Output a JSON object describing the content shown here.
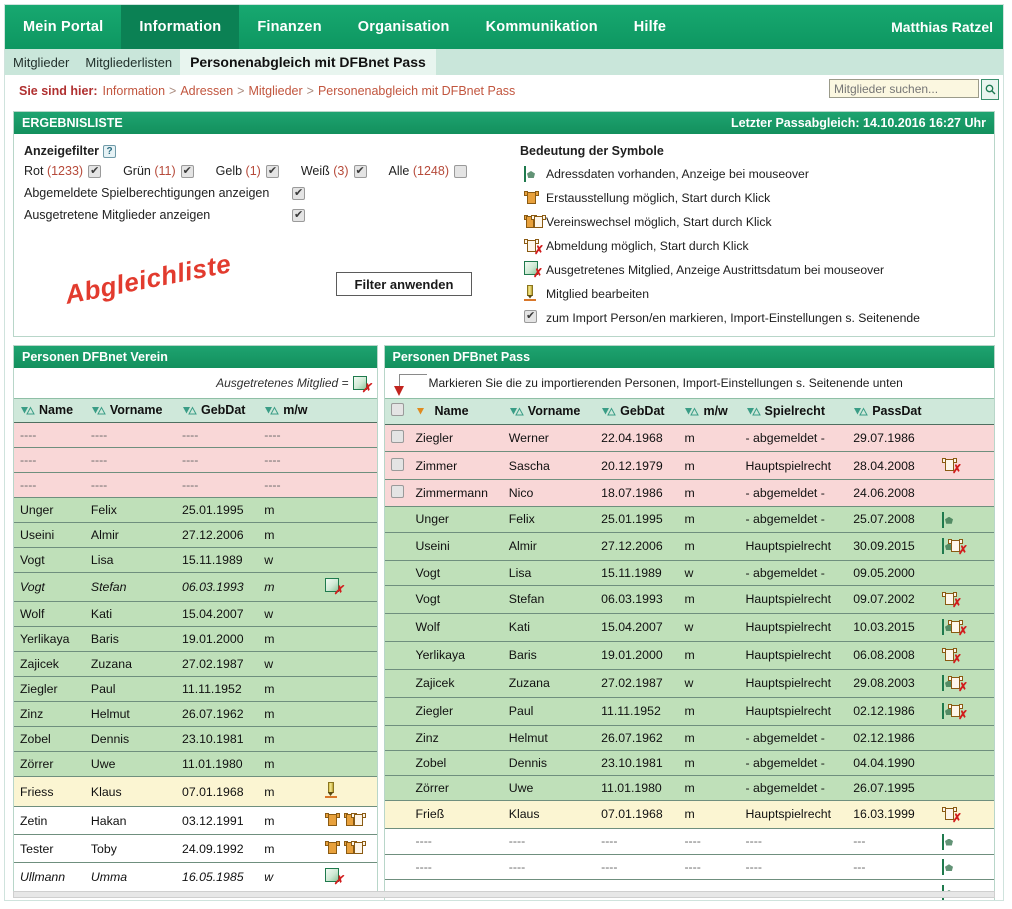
{
  "nav": {
    "items": [
      {
        "label": "Mein Portal",
        "active": false
      },
      {
        "label": "Information",
        "active": true
      },
      {
        "label": "Finanzen",
        "active": false
      },
      {
        "label": "Organisation",
        "active": false
      },
      {
        "label": "Kommunikation",
        "active": false
      },
      {
        "label": "Hilfe",
        "active": false
      }
    ],
    "user": "Matthias Ratzel"
  },
  "subtabs": [
    {
      "label": "Mitglieder",
      "active": false
    },
    {
      "label": "Mitgliederlisten",
      "active": false
    },
    {
      "label": "Personenabgleich mit DFBnet Pass",
      "active": true
    }
  ],
  "breadcrumb": {
    "lead": "Sie sind hier:",
    "items": [
      "Information",
      "Adressen",
      "Mitglieder",
      "Personenabgleich mit DFBnet Pass"
    ],
    "separator": ">"
  },
  "search": {
    "placeholder": "Mitglieder suchen...",
    "value": "",
    "button_icon": "search-icon"
  },
  "results_panel": {
    "title": "ERGEBNISLISTE",
    "last_sync": "Letzter Passabgleich: 14.10.2016 16:27 Uhr"
  },
  "filters": {
    "title": "Anzeigefilter",
    "help_icon": "help-icon",
    "color_options": [
      {
        "label": "Rot",
        "count": "(1233)",
        "checked": true
      },
      {
        "label": "Grün",
        "count": "(11)",
        "checked": true
      },
      {
        "label": "Gelb",
        "count": "(1)",
        "checked": true
      },
      {
        "label": "Weiß",
        "count": "(3)",
        "checked": true
      },
      {
        "label": "Alle",
        "count": "(1248)",
        "checked": false
      }
    ],
    "toggles": [
      {
        "label": "Abgemeldete Spielberechtigungen anzeigen",
        "checked": true
      },
      {
        "label": "Ausgetretene Mitglieder anzeigen",
        "checked": true
      }
    ],
    "apply_button": "Filter anwenden",
    "watermark": "Abgleichliste"
  },
  "legend": {
    "title": "Bedeutung der Symbole",
    "rows": [
      {
        "icon": "address-data-icon",
        "text": "Adressdaten vorhanden, Anzeige bei mouseover"
      },
      {
        "icon": "jersey-first-issue-icon",
        "text": "Erstausstellung möglich, Start durch Klick"
      },
      {
        "icon": "jersey-club-change-icon",
        "text": "Vereinswechsel möglich, Start durch Klick"
      },
      {
        "icon": "deregister-icon",
        "text": "Abmeldung möglich, Start durch Klick"
      },
      {
        "icon": "member-left-icon",
        "text": "Ausgetretenes Mitglied, Anzeige Austrittsdatum bei mouseover"
      },
      {
        "icon": "edit-member-icon",
        "text": "Mitglied bearbeiten"
      },
      {
        "icon": "import-checkbox-icon",
        "text": "zum Import Person/en markieren, Import-Einstellungen s. Seitenende"
      }
    ]
  },
  "left_table": {
    "title": "Personen DFBnet Verein",
    "note": "Ausgetretenes Mitglied =",
    "note_icon": "member-left-icon",
    "columns": [
      "Name",
      "Vorname",
      "GebDat",
      "m/w"
    ],
    "rows": [
      {
        "name": "----",
        "vorname": "----",
        "gebdat": "----",
        "mw": "----",
        "icons": [],
        "color": "rot",
        "italic": false
      },
      {
        "name": "----",
        "vorname": "----",
        "gebdat": "----",
        "mw": "----",
        "icons": [],
        "color": "rot",
        "italic": false
      },
      {
        "name": "----",
        "vorname": "----",
        "gebdat": "----",
        "mw": "----",
        "icons": [],
        "color": "rot",
        "italic": false
      },
      {
        "name": "Unger",
        "vorname": "Felix",
        "gebdat": "25.01.1995",
        "mw": "m",
        "icons": [],
        "color": "gruen",
        "italic": false
      },
      {
        "name": "Useini",
        "vorname": "Almir",
        "gebdat": "27.12.2006",
        "mw": "m",
        "icons": [],
        "color": "gruen",
        "italic": false
      },
      {
        "name": "Vogt",
        "vorname": "Lisa",
        "gebdat": "15.11.1989",
        "mw": "w",
        "icons": [],
        "color": "gruen",
        "italic": false
      },
      {
        "name": "Vogt",
        "vorname": "Stefan",
        "gebdat": "06.03.1993",
        "mw": "m",
        "icons": [
          "member-left-icon"
        ],
        "color": "gruen",
        "italic": true
      },
      {
        "name": "Wolf",
        "vorname": "Kati",
        "gebdat": "15.04.2007",
        "mw": "w",
        "icons": [],
        "color": "gruen",
        "italic": false
      },
      {
        "name": "Yerlikaya",
        "vorname": "Baris",
        "gebdat": "19.01.2000",
        "mw": "m",
        "icons": [],
        "color": "gruen",
        "italic": false
      },
      {
        "name": "Zajicek",
        "vorname": "Zuzana",
        "gebdat": "27.02.1987",
        "mw": "w",
        "icons": [],
        "color": "gruen",
        "italic": false
      },
      {
        "name": "Ziegler",
        "vorname": "Paul",
        "gebdat": "11.11.1952",
        "mw": "m",
        "icons": [],
        "color": "gruen",
        "italic": false
      },
      {
        "name": "Zinz",
        "vorname": "Helmut",
        "gebdat": "26.07.1962",
        "mw": "m",
        "icons": [],
        "color": "gruen",
        "italic": false
      },
      {
        "name": "Zobel",
        "vorname": "Dennis",
        "gebdat": "23.10.1981",
        "mw": "m",
        "icons": [],
        "color": "gruen",
        "italic": false
      },
      {
        "name": "Zörrer",
        "vorname": "Uwe",
        "gebdat": "11.01.1980",
        "mw": "m",
        "icons": [],
        "color": "gruen",
        "italic": false
      },
      {
        "name": "Friess",
        "vorname": "Klaus",
        "gebdat": "07.01.1968",
        "mw": "m",
        "icons": [
          "edit-member-icon"
        ],
        "color": "gelb",
        "italic": false
      },
      {
        "name": "Zetin",
        "vorname": "Hakan",
        "gebdat": "03.12.1991",
        "mw": "m",
        "icons": [
          "jersey-first-issue-icon",
          "jersey-club-change-icon"
        ],
        "color": "weiss",
        "italic": false
      },
      {
        "name": "Tester",
        "vorname": "Toby",
        "gebdat": "24.09.1992",
        "mw": "m",
        "icons": [
          "jersey-first-issue-icon",
          "jersey-club-change-icon"
        ],
        "color": "weiss",
        "italic": false
      },
      {
        "name": "Ullmann",
        "vorname": "Umma",
        "gebdat": "16.05.1985",
        "mw": "w",
        "icons": [
          "member-left-icon"
        ],
        "color": "weiss",
        "italic": true
      }
    ]
  },
  "right_table": {
    "title": "Personen DFBnet Pass",
    "note": "Markieren Sie die zu importierenden Personen, Import-Einstellungen s. Seitenende unten",
    "columns": [
      "Name",
      "Vorname",
      "GebDat",
      "m/w",
      "Spielrecht",
      "PassDat"
    ],
    "header_checkbox": false,
    "sorted_column": "Name",
    "rows": [
      {
        "checkbox": false,
        "name": "Ziegler",
        "vorname": "Werner",
        "gebdat": "22.04.1968",
        "mw": "m",
        "spielrecht": "- abgemeldet -",
        "passdat": "29.07.1986",
        "icons": [],
        "color": "rot"
      },
      {
        "checkbox": false,
        "name": "Zimmer",
        "vorname": "Sascha",
        "gebdat": "20.12.1979",
        "mw": "m",
        "spielrecht": "Hauptspielrecht",
        "passdat": "28.04.2008",
        "icons": [
          "deregister-icon"
        ],
        "color": "rot"
      },
      {
        "checkbox": false,
        "name": "Zimmermann",
        "vorname": "Nico",
        "gebdat": "18.07.1986",
        "mw": "m",
        "spielrecht": "- abgemeldet -",
        "passdat": "24.06.2008",
        "icons": [],
        "color": "rot"
      },
      {
        "checkbox": null,
        "name": "Unger",
        "vorname": "Felix",
        "gebdat": "25.01.1995",
        "mw": "m",
        "spielrecht": "- abgemeldet -",
        "passdat": "25.07.2008",
        "icons": [
          "address-data-icon"
        ],
        "color": "gruen"
      },
      {
        "checkbox": null,
        "name": "Useini",
        "vorname": "Almir",
        "gebdat": "27.12.2006",
        "mw": "m",
        "spielrecht": "Hauptspielrecht",
        "passdat": "30.09.2015",
        "icons": [
          "address-data-icon",
          "deregister-icon"
        ],
        "color": "gruen"
      },
      {
        "checkbox": null,
        "name": "Vogt",
        "vorname": "Lisa",
        "gebdat": "15.11.1989",
        "mw": "w",
        "spielrecht": "- abgemeldet -",
        "passdat": "09.05.2000",
        "icons": [],
        "color": "gruen"
      },
      {
        "checkbox": null,
        "name": "Vogt",
        "vorname": "Stefan",
        "gebdat": "06.03.1993",
        "mw": "m",
        "spielrecht": "Hauptspielrecht",
        "passdat": "09.07.2002",
        "icons": [
          "deregister-icon"
        ],
        "color": "gruen"
      },
      {
        "checkbox": null,
        "name": "Wolf",
        "vorname": "Kati",
        "gebdat": "15.04.2007",
        "mw": "w",
        "spielrecht": "Hauptspielrecht",
        "passdat": "10.03.2015",
        "icons": [
          "address-data-icon",
          "deregister-icon"
        ],
        "color": "gruen"
      },
      {
        "checkbox": null,
        "name": "Yerlikaya",
        "vorname": "Baris",
        "gebdat": "19.01.2000",
        "mw": "m",
        "spielrecht": "Hauptspielrecht",
        "passdat": "06.08.2008",
        "icons": [
          "deregister-icon"
        ],
        "color": "gruen"
      },
      {
        "checkbox": null,
        "name": "Zajicek",
        "vorname": "Zuzana",
        "gebdat": "27.02.1987",
        "mw": "w",
        "spielrecht": "Hauptspielrecht",
        "passdat": "29.08.2003",
        "icons": [
          "address-data-icon",
          "deregister-icon"
        ],
        "color": "gruen"
      },
      {
        "checkbox": null,
        "name": "Ziegler",
        "vorname": "Paul",
        "gebdat": "11.11.1952",
        "mw": "m",
        "spielrecht": "Hauptspielrecht",
        "passdat": "02.12.1986",
        "icons": [
          "address-data-icon",
          "deregister-icon"
        ],
        "color": "gruen"
      },
      {
        "checkbox": null,
        "name": "Zinz",
        "vorname": "Helmut",
        "gebdat": "26.07.1962",
        "mw": "m",
        "spielrecht": "- abgemeldet -",
        "passdat": "02.12.1986",
        "icons": [],
        "color": "gruen"
      },
      {
        "checkbox": null,
        "name": "Zobel",
        "vorname": "Dennis",
        "gebdat": "23.10.1981",
        "mw": "m",
        "spielrecht": "- abgemeldet -",
        "passdat": "04.04.1990",
        "icons": [],
        "color": "gruen"
      },
      {
        "checkbox": null,
        "name": "Zörrer",
        "vorname": "Uwe",
        "gebdat": "11.01.1980",
        "mw": "m",
        "spielrecht": "- abgemeldet -",
        "passdat": "26.07.1995",
        "icons": [],
        "color": "gruen"
      },
      {
        "checkbox": null,
        "name": "Frieß",
        "vorname": "Klaus",
        "gebdat": "07.01.1968",
        "mw": "m",
        "spielrecht": "Hauptspielrecht",
        "passdat": "16.03.1999",
        "icons": [
          "deregister-icon"
        ],
        "color": "gelb"
      },
      {
        "checkbox": null,
        "name": "----",
        "vorname": "----",
        "gebdat": "----",
        "mw": "----",
        "spielrecht": "----",
        "passdat": "---",
        "icons": [
          "address-data-icon"
        ],
        "color": "weiss"
      },
      {
        "checkbox": null,
        "name": "----",
        "vorname": "----",
        "gebdat": "----",
        "mw": "----",
        "spielrecht": "----",
        "passdat": "---",
        "icons": [
          "address-data-icon"
        ],
        "color": "weiss"
      },
      {
        "checkbox": null,
        "name": "----",
        "vorname": "----",
        "gebdat": "----",
        "mw": "----",
        "spielrecht": "----",
        "passdat": "---",
        "icons": [
          "address-data-icon"
        ],
        "color": "weiss"
      }
    ]
  },
  "colors": {
    "brand_green": "#13a06a",
    "brand_green_dark": "#0b8154",
    "panel_header": "#1a9c68",
    "row_red": "#f9d7d7",
    "row_green": "#bfe0b9",
    "row_yellow": "#fbf5d2",
    "row_white": "#ffffff",
    "watermark_red": "#e23b2e",
    "breadcrumb_red": "#b03030"
  }
}
